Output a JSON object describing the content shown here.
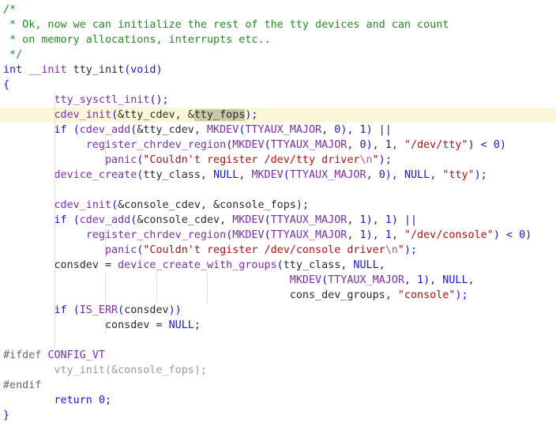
{
  "editor": {
    "colors": {
      "background": "#ffffff",
      "current_line": "#fbf8d8",
      "comment": "#1f8a1f",
      "keyword": "#1717d6",
      "function": "#7a2fa8",
      "string": "#b01010",
      "preprocessor": "#6a6a6a"
    },
    "lines": [
      {
        "tokens": [
          {
            "t": "/*",
            "k": "comment"
          }
        ]
      },
      {
        "tokens": [
          {
            "t": " * Ok, now we can initialize the rest of the tty devices and can count",
            "k": "comment"
          }
        ]
      },
      {
        "tokens": [
          {
            "t": " * on memory allocations, interrupts etc..",
            "k": "comment"
          }
        ]
      },
      {
        "tokens": [
          {
            "t": " */",
            "k": "comment"
          }
        ]
      },
      {
        "tokens": [
          {
            "t": "int",
            "k": "keyword"
          },
          {
            "t": " ",
            "k": "plain"
          },
          {
            "t": "__init",
            "k": "func"
          },
          {
            "t": " tty_init",
            "k": "plain"
          },
          {
            "t": "(",
            "k": "punct"
          },
          {
            "t": "void",
            "k": "keyword"
          },
          {
            "t": ")",
            "k": "punct"
          }
        ]
      },
      {
        "tokens": [
          {
            "t": "{",
            "k": "punct"
          }
        ]
      },
      {
        "guides": [
          1
        ],
        "tokens": [
          {
            "t": "        ",
            "k": "plain"
          },
          {
            "t": "tty_sysctl_init",
            "k": "func"
          },
          {
            "t": "();",
            "k": "punct"
          }
        ]
      },
      {
        "current": true,
        "guides": [
          1
        ],
        "tokens": [
          {
            "t": "        ",
            "k": "plain"
          },
          {
            "t": "cdev_init",
            "k": "func"
          },
          {
            "t": "(",
            "k": "punct"
          },
          {
            "t": "&tty_cdev, &",
            "k": "plain"
          },
          {
            "t": "tty_fops",
            "k": "highlight"
          },
          {
            "t": ");",
            "k": "punct"
          }
        ]
      },
      {
        "guides": [
          1
        ],
        "tokens": [
          {
            "t": "        ",
            "k": "plain"
          },
          {
            "t": "if",
            "k": "keyword"
          },
          {
            "t": " ",
            "k": "plain"
          },
          {
            "t": "(",
            "k": "punct"
          },
          {
            "t": "cdev_add",
            "k": "func"
          },
          {
            "t": "(",
            "k": "punct"
          },
          {
            "t": "&tty_cdev, ",
            "k": "plain"
          },
          {
            "t": "MKDEV",
            "k": "macro"
          },
          {
            "t": "(",
            "k": "punct"
          },
          {
            "t": "TTYAUX_MAJOR",
            "k": "macro"
          },
          {
            "t": ", ",
            "k": "plain"
          },
          {
            "t": "0",
            "k": "number"
          },
          {
            "t": "), ",
            "k": "punct"
          },
          {
            "t": "1",
            "k": "number"
          },
          {
            "t": ") ||",
            "k": "punct"
          }
        ]
      },
      {
        "guides": [
          1,
          2
        ],
        "tokens": [
          {
            "t": "             ",
            "k": "plain"
          },
          {
            "t": "register_chrdev_region",
            "k": "func"
          },
          {
            "t": "(",
            "k": "punct"
          },
          {
            "t": "MKDEV",
            "k": "macro"
          },
          {
            "t": "(",
            "k": "punct"
          },
          {
            "t": "TTYAUX_MAJOR",
            "k": "macro"
          },
          {
            "t": ", ",
            "k": "plain"
          },
          {
            "t": "0",
            "k": "number"
          },
          {
            "t": "), ",
            "k": "punct"
          },
          {
            "t": "1",
            "k": "number"
          },
          {
            "t": ", ",
            "k": "plain"
          },
          {
            "t": "\"/dev/tty\"",
            "k": "string"
          },
          {
            "t": ") < ",
            "k": "punct"
          },
          {
            "t": "0",
            "k": "number"
          },
          {
            "t": ")",
            "k": "punct"
          }
        ]
      },
      {
        "guides": [
          1,
          2
        ],
        "tokens": [
          {
            "t": "                ",
            "k": "plain"
          },
          {
            "t": "panic",
            "k": "func"
          },
          {
            "t": "(",
            "k": "punct"
          },
          {
            "t": "\"Couldn't register /dev/tty driver",
            "k": "string"
          },
          {
            "t": "\\n",
            "k": "escape"
          },
          {
            "t": "\"",
            "k": "string"
          },
          {
            "t": ");",
            "k": "punct"
          }
        ]
      },
      {
        "guides": [
          1
        ],
        "tokens": [
          {
            "t": "        ",
            "k": "plain"
          },
          {
            "t": "device_create",
            "k": "func"
          },
          {
            "t": "(",
            "k": "punct"
          },
          {
            "t": "tty_class, ",
            "k": "plain"
          },
          {
            "t": "NULL",
            "k": "const"
          },
          {
            "t": ", ",
            "k": "plain"
          },
          {
            "t": "MKDEV",
            "k": "macro"
          },
          {
            "t": "(",
            "k": "punct"
          },
          {
            "t": "TTYAUX_MAJOR",
            "k": "macro"
          },
          {
            "t": ", ",
            "k": "plain"
          },
          {
            "t": "0",
            "k": "number"
          },
          {
            "t": "), ",
            "k": "punct"
          },
          {
            "t": "NULL",
            "k": "const"
          },
          {
            "t": ", ",
            "k": "plain"
          },
          {
            "t": "\"tty\"",
            "k": "string"
          },
          {
            "t": ");",
            "k": "punct"
          }
        ]
      },
      {
        "guides": [
          1
        ],
        "tokens": [
          {
            "t": " ",
            "k": "plain"
          }
        ]
      },
      {
        "guides": [
          1
        ],
        "tokens": [
          {
            "t": "        ",
            "k": "plain"
          },
          {
            "t": "cdev_init",
            "k": "func"
          },
          {
            "t": "(",
            "k": "punct"
          },
          {
            "t": "&console_cdev, &console_fops",
            "k": "plain"
          },
          {
            "t": ");",
            "k": "punct"
          }
        ]
      },
      {
        "guides": [
          1
        ],
        "tokens": [
          {
            "t": "        ",
            "k": "plain"
          },
          {
            "t": "if",
            "k": "keyword"
          },
          {
            "t": " ",
            "k": "plain"
          },
          {
            "t": "(",
            "k": "punct"
          },
          {
            "t": "cdev_add",
            "k": "func"
          },
          {
            "t": "(",
            "k": "punct"
          },
          {
            "t": "&console_cdev, ",
            "k": "plain"
          },
          {
            "t": "MKDEV",
            "k": "macro"
          },
          {
            "t": "(",
            "k": "punct"
          },
          {
            "t": "TTYAUX_MAJOR",
            "k": "macro"
          },
          {
            "t": ", ",
            "k": "plain"
          },
          {
            "t": "1",
            "k": "number"
          },
          {
            "t": "), ",
            "k": "punct"
          },
          {
            "t": "1",
            "k": "number"
          },
          {
            "t": ") ||",
            "k": "punct"
          }
        ]
      },
      {
        "guides": [
          1,
          2
        ],
        "tokens": [
          {
            "t": "             ",
            "k": "plain"
          },
          {
            "t": "register_chrdev_region",
            "k": "func"
          },
          {
            "t": "(",
            "k": "punct"
          },
          {
            "t": "MKDEV",
            "k": "macro"
          },
          {
            "t": "(",
            "k": "punct"
          },
          {
            "t": "TTYAUX_MAJOR",
            "k": "macro"
          },
          {
            "t": ", ",
            "k": "plain"
          },
          {
            "t": "1",
            "k": "number"
          },
          {
            "t": "), ",
            "k": "punct"
          },
          {
            "t": "1",
            "k": "number"
          },
          {
            "t": ", ",
            "k": "plain"
          },
          {
            "t": "\"/dev/console\"",
            "k": "string"
          },
          {
            "t": ") < ",
            "k": "punct"
          },
          {
            "t": "0",
            "k": "number"
          },
          {
            "t": ")",
            "k": "punct"
          }
        ]
      },
      {
        "guides": [
          1,
          2
        ],
        "tokens": [
          {
            "t": "                ",
            "k": "plain"
          },
          {
            "t": "panic",
            "k": "func"
          },
          {
            "t": "(",
            "k": "punct"
          },
          {
            "t": "\"Couldn't register /dev/console driver",
            "k": "string"
          },
          {
            "t": "\\n",
            "k": "escape"
          },
          {
            "t": "\"",
            "k": "string"
          },
          {
            "t": ");",
            "k": "punct"
          }
        ]
      },
      {
        "guides": [
          1
        ],
        "tokens": [
          {
            "t": "        ",
            "k": "plain"
          },
          {
            "t": "consdev = ",
            "k": "plain"
          },
          {
            "t": "device_create_with_groups",
            "k": "func"
          },
          {
            "t": "(",
            "k": "punct"
          },
          {
            "t": "tty_class, ",
            "k": "plain"
          },
          {
            "t": "NULL",
            "k": "const"
          },
          {
            "t": ",",
            "k": "plain"
          }
        ]
      },
      {
        "guides": [
          1,
          2,
          3,
          4
        ],
        "tokens": [
          {
            "t": "                                             ",
            "k": "plain"
          },
          {
            "t": "MKDEV",
            "k": "macro"
          },
          {
            "t": "(",
            "k": "punct"
          },
          {
            "t": "TTYAUX_MAJOR",
            "k": "macro"
          },
          {
            "t": ", ",
            "k": "plain"
          },
          {
            "t": "1",
            "k": "number"
          },
          {
            "t": "), ",
            "k": "punct"
          },
          {
            "t": "NULL",
            "k": "const"
          },
          {
            "t": ",",
            "k": "plain"
          }
        ]
      },
      {
        "guides": [
          1,
          2,
          3,
          4
        ],
        "tokens": [
          {
            "t": "                                             ",
            "k": "plain"
          },
          {
            "t": "cons_dev_groups, ",
            "k": "plain"
          },
          {
            "t": "\"console\"",
            "k": "string"
          },
          {
            "t": ");",
            "k": "punct"
          }
        ]
      },
      {
        "guides": [
          1
        ],
        "tokens": [
          {
            "t": "        ",
            "k": "plain"
          },
          {
            "t": "if",
            "k": "keyword"
          },
          {
            "t": " ",
            "k": "plain"
          },
          {
            "t": "(",
            "k": "punct"
          },
          {
            "t": "IS_ERR",
            "k": "macro"
          },
          {
            "t": "(",
            "k": "punct"
          },
          {
            "t": "consdev",
            "k": "plain"
          },
          {
            "t": "))",
            "k": "punct"
          }
        ]
      },
      {
        "guides": [
          1,
          2
        ],
        "tokens": [
          {
            "t": "                ",
            "k": "plain"
          },
          {
            "t": "consdev = ",
            "k": "plain"
          },
          {
            "t": "NULL",
            "k": "const"
          },
          {
            "t": ";",
            "k": "punct"
          }
        ]
      },
      {
        "guides": [
          1
        ],
        "tokens": [
          {
            "t": " ",
            "k": "plain"
          }
        ]
      },
      {
        "tokens": [
          {
            "t": "#ifdef",
            "k": "preproc"
          },
          {
            "t": " ",
            "k": "plain"
          },
          {
            "t": "CONFIG_VT",
            "k": "macro"
          }
        ]
      },
      {
        "tokens": [
          {
            "t": "        ",
            "k": "plain"
          },
          {
            "t": "vty_init(&console_fops);",
            "k": "disabled"
          }
        ]
      },
      {
        "tokens": [
          {
            "t": "#endif",
            "k": "preproc"
          }
        ]
      },
      {
        "tokens": [
          {
            "t": "        ",
            "k": "plain"
          },
          {
            "t": "return",
            "k": "keyword"
          },
          {
            "t": " ",
            "k": "plain"
          },
          {
            "t": "0",
            "k": "number"
          },
          {
            "t": ";",
            "k": "punct"
          }
        ]
      },
      {
        "tokens": [
          {
            "t": "}",
            "k": "punct"
          }
        ]
      }
    ]
  }
}
